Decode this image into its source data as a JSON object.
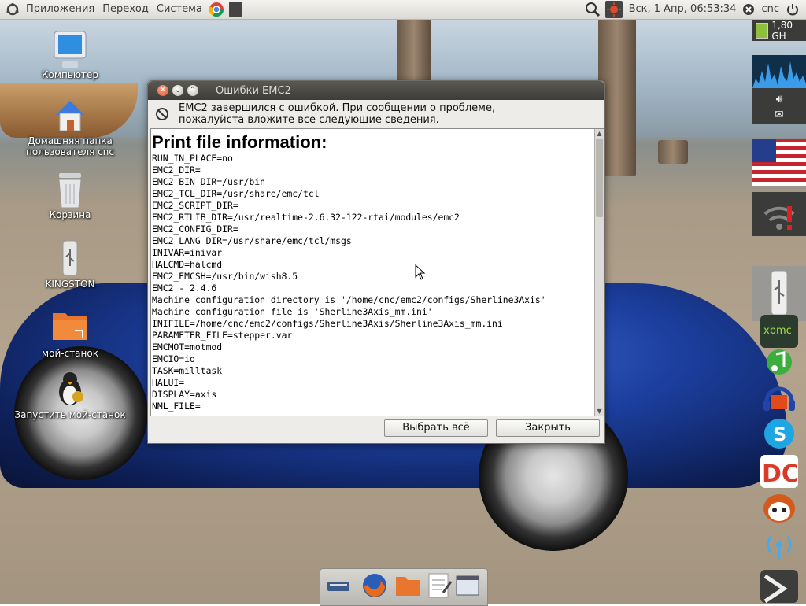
{
  "top_panel": {
    "menus": [
      "Приложения",
      "Переход",
      "Система"
    ],
    "datetime": "Вск, 1 Апр, 06:53:34",
    "user": "cnc",
    "icons": [
      "ubuntu-logo-icon",
      "chrome-icon",
      "flash-drive-icon",
      "search-icon",
      "indicator-icon",
      "close-circle-icon",
      "power-icon"
    ]
  },
  "desktop_icons": [
    {
      "label": "Компьютер",
      "icon": "computer-icon"
    },
    {
      "label": "Домашняя папка пользователя cnc",
      "icon": "home-folder-icon"
    },
    {
      "label": "Корзина",
      "icon": "trash-icon"
    },
    {
      "label": "KINGSTON",
      "icon": "usb-drive-icon"
    },
    {
      "label": "мой-станок",
      "icon": "folder-icon"
    },
    {
      "label": "Запустить мой-станок",
      "icon": "linuxcnc-penguin-icon"
    }
  ],
  "dialog": {
    "title": "Ошибки EMC2",
    "message_line1": "EMC2 завершился с ошибкой. При сообщении о проблеме,",
    "message_line2": "пожалуйста вложите все следующие сведения.",
    "heading": "Print file information:",
    "lines": [
      "RUN_IN_PLACE=no",
      "EMC2_DIR=",
      "EMC2_BIN_DIR=/usr/bin",
      "EMC2_TCL_DIR=/usr/share/emc/tcl",
      "EMC2_SCRIPT_DIR=",
      "EMC2_RTLIB_DIR=/usr/realtime-2.6.32-122-rtai/modules/emc2",
      "EMC2_CONFIG_DIR=",
      "EMC2_LANG_DIR=/usr/share/emc/tcl/msgs",
      "INIVAR=inivar",
      "HALCMD=halcmd",
      "EMC2_EMCSH=/usr/bin/wish8.5",
      "EMC2 - 2.4.6",
      "Machine configuration directory is '/home/cnc/emc2/configs/Sherline3Axis'",
      "Machine configuration file is 'Sherline3Axis_mm.ini'",
      "INIFILE=/home/cnc/emc2/configs/Sherline3Axis/Sherline3Axis_mm.ini",
      "PARAMETER_FILE=stepper.var",
      "EMCMOT=motmod",
      "EMCIO=io",
      "TASK=milltask",
      "HALUI=",
      "DISPLAY=axis",
      "NML_FILE="
    ],
    "select_all_label": "Выбрать всё",
    "close_label": "Закрыть"
  },
  "right_dock": {
    "cpu_freq": "1,80 GH",
    "apps": [
      "xbmc-icon",
      "mms-icon",
      "audacity-icon",
      "skype-icon",
      "docky-icon",
      "firefox-fox-icon",
      "wireless-icon",
      "arrow-icon"
    ]
  },
  "bottom_dock": {
    "icons": [
      "scanner-icon",
      "firefox-icon",
      "folder-icon",
      "text-editor-icon",
      "window-icon"
    ]
  },
  "colors": {
    "titlebar": "#3d3c38",
    "close_button": "#e2552d",
    "dialog_bg": "#edece9",
    "car_blue": "#1c3f9f"
  }
}
